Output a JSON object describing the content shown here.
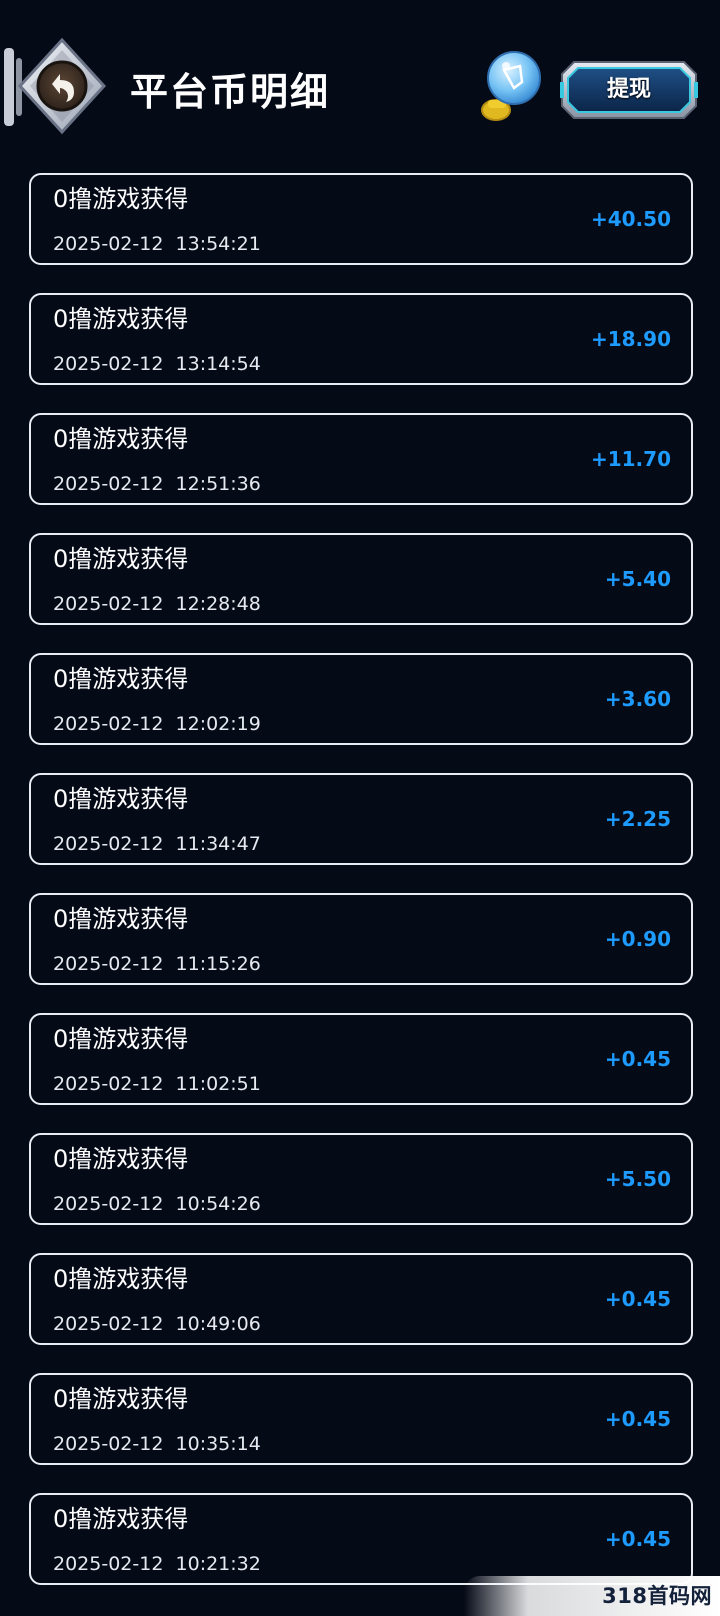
{
  "header": {
    "title": "平台币明细",
    "withdraw_label": "提现"
  },
  "records": [
    {
      "title": "0撸游戏获得",
      "date": "2025-02-12",
      "time": "13:54:21",
      "amount": "+40.50"
    },
    {
      "title": "0撸游戏获得",
      "date": "2025-02-12",
      "time": "13:14:54",
      "amount": "+18.90"
    },
    {
      "title": "0撸游戏获得",
      "date": "2025-02-12",
      "time": "12:51:36",
      "amount": "+11.70"
    },
    {
      "title": "0撸游戏获得",
      "date": "2025-02-12",
      "time": "12:28:48",
      "amount": "+5.40"
    },
    {
      "title": "0撸游戏获得",
      "date": "2025-02-12",
      "time": "12:02:19",
      "amount": "+3.60"
    },
    {
      "title": "0撸游戏获得",
      "date": "2025-02-12",
      "time": "11:34:47",
      "amount": "+2.25"
    },
    {
      "title": "0撸游戏获得",
      "date": "2025-02-12",
      "time": "11:15:26",
      "amount": "+0.90"
    },
    {
      "title": "0撸游戏获得",
      "date": "2025-02-12",
      "time": "11:02:51",
      "amount": "+0.45"
    },
    {
      "title": "0撸游戏获得",
      "date": "2025-02-12",
      "time": "10:54:26",
      "amount": "+5.50"
    },
    {
      "title": "0撸游戏获得",
      "date": "2025-02-12",
      "time": "10:49:06",
      "amount": "+0.45"
    },
    {
      "title": "0撸游戏获得",
      "date": "2025-02-12",
      "time": "10:35:14",
      "amount": "+0.45"
    },
    {
      "title": "0撸游戏获得",
      "date": "2025-02-12",
      "time": "10:21:32",
      "amount": "+0.45"
    }
  ],
  "watermark": "318首码网 www.e318.com",
  "colors": {
    "background": "#050a17",
    "amount": "#1e9bff",
    "card_border": "#e9edf3"
  },
  "icons": {
    "back": "back-arrow-icon",
    "hint": "lightbulb-icon"
  }
}
